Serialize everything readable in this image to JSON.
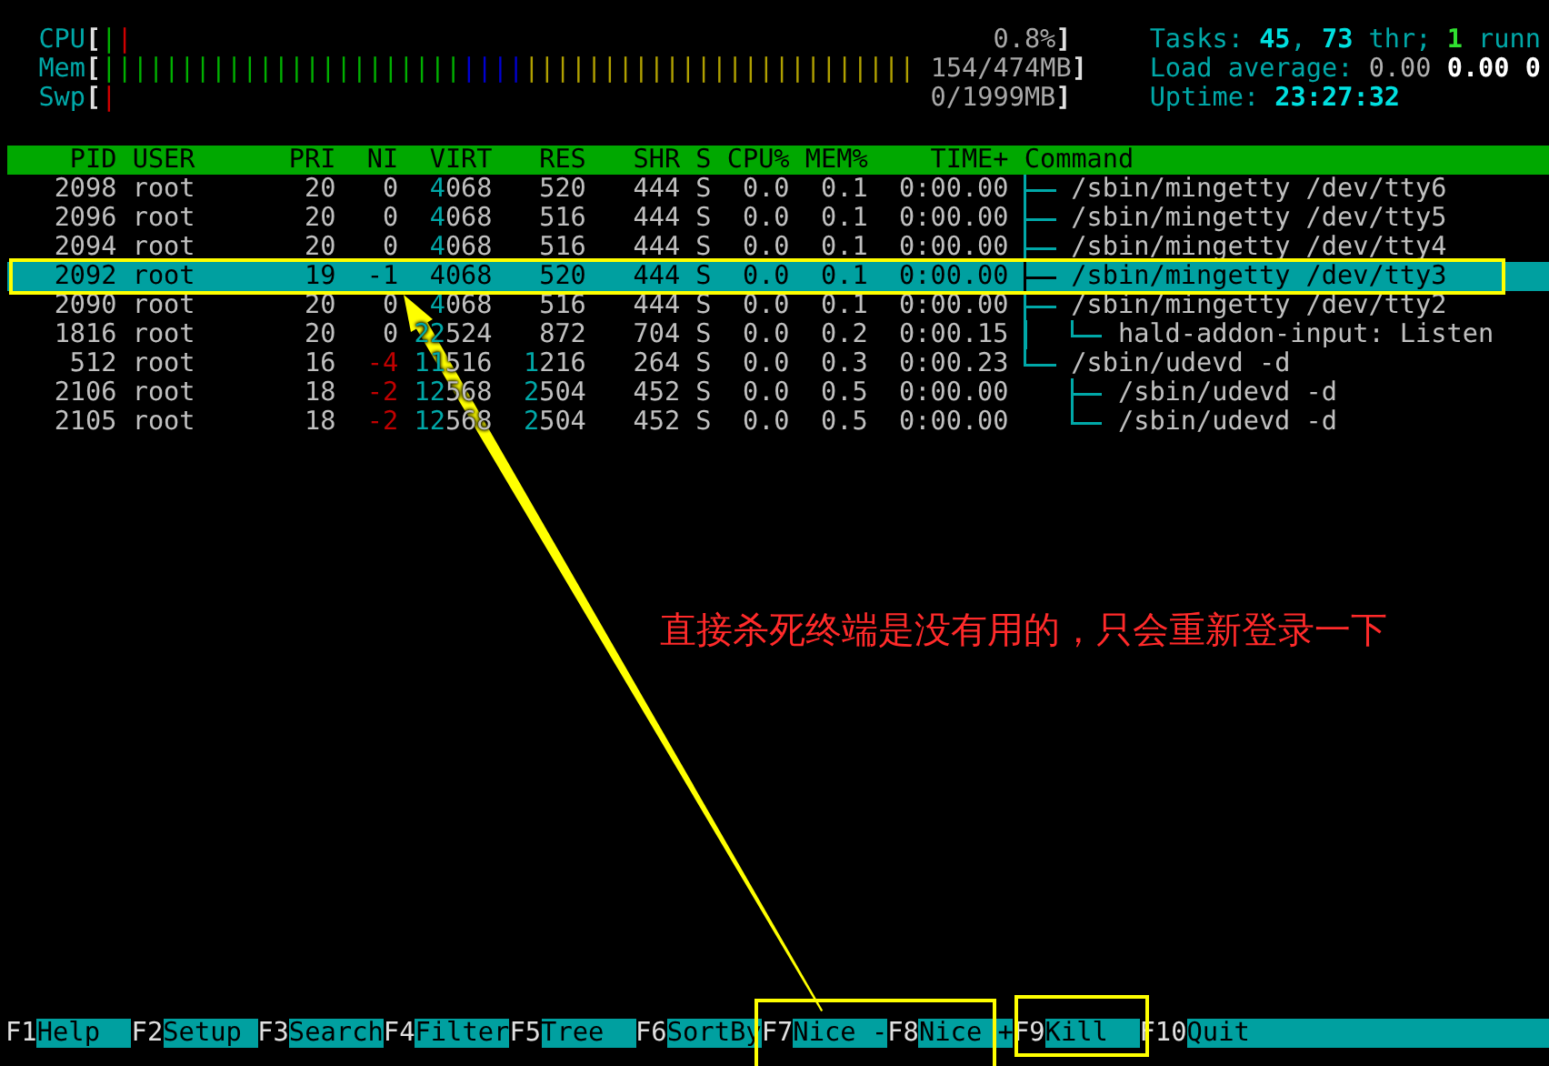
{
  "meters": [
    {
      "label": "CPU",
      "open_bracket": "[",
      "close_bracket": "]",
      "value": "0.8%",
      "segments": [
        {
          "color": "#00b000",
          "bars": "|"
        },
        {
          "color": "#d00000",
          "bars": "|"
        }
      ]
    },
    {
      "label": "Mem",
      "open_bracket": "[",
      "close_bracket": "]",
      "value": "154/474MB",
      "segments": [
        {
          "color": "#00b000",
          "bars": "|||||||||||||||||||||||"
        },
        {
          "color": "#0000d0",
          "bars": "||||"
        },
        {
          "color": "#b0a000",
          "bars": "|||||||||||||||||||||||||"
        }
      ]
    },
    {
      "label": "Swp",
      "open_bracket": "[",
      "close_bracket": "]",
      "value": "0/1999MB",
      "segments": [
        {
          "color": "#d00000",
          "bars": "|"
        }
      ]
    }
  ],
  "stats": [
    [
      {
        "text": "Tasks:",
        "kind": "label"
      },
      {
        "text": "45",
        "kind": "value"
      },
      {
        "text": ",",
        "kind": "punct"
      },
      {
        "text": "73",
        "kind": "value"
      },
      {
        "text": "thr;",
        "kind": "label"
      },
      {
        "text": "1",
        "kind": "running"
      },
      {
        "text": "runn",
        "kind": "label"
      }
    ],
    [
      {
        "text": "Load average:",
        "kind": "label"
      },
      {
        "text": "0.00",
        "kind": "load"
      },
      {
        "text": "0.00",
        "kind": "load_bright"
      },
      {
        "text": "0",
        "kind": "load_bright"
      }
    ],
    [
      {
        "text": "Uptime:",
        "kind": "label"
      },
      {
        "text": "23:27:32",
        "kind": "value"
      }
    ]
  ],
  "columns": [
    "PID",
    "USER",
    "PRI",
    "NI",
    "VIRT",
    "RES",
    "SHR",
    "S",
    "CPU%",
    "MEM%",
    "TIME+",
    "Command"
  ],
  "rows": [
    {
      "pid": "2098",
      "user": "root",
      "pri": "20",
      "ni": "0",
      "nice_negative": false,
      "virt": "4068",
      "res": "520",
      "shr": "444",
      "s": "S",
      "cpu": "0.0",
      "mem": "0.1",
      "time": "0:00.00",
      "command": "/sbin/mingetty /dev/tty6",
      "selected": false
    },
    {
      "pid": "2096",
      "user": "root",
      "pri": "20",
      "ni": "0",
      "nice_negative": false,
      "virt": "4068",
      "res": "516",
      "shr": "444",
      "s": "S",
      "cpu": "0.0",
      "mem": "0.1",
      "time": "0:00.00",
      "command": "/sbin/mingetty /dev/tty5",
      "selected": false
    },
    {
      "pid": "2094",
      "user": "root",
      "pri": "20",
      "ni": "0",
      "nice_negative": false,
      "virt": "4068",
      "res": "516",
      "shr": "444",
      "s": "S",
      "cpu": "0.0",
      "mem": "0.1",
      "time": "0:00.00",
      "command": "/sbin/mingetty /dev/tty4",
      "selected": false
    },
    {
      "pid": "2092",
      "user": "root",
      "pri": "19",
      "ni": "-1",
      "nice_negative": false,
      "virt": "4068",
      "res": "520",
      "shr": "444",
      "s": "S",
      "cpu": "0.0",
      "mem": "0.1",
      "time": "0:00.00",
      "command": "/sbin/mingetty /dev/tty3",
      "selected": true
    },
    {
      "pid": "2090",
      "user": "root",
      "pri": "20",
      "ni": "0",
      "nice_negative": false,
      "virt": "4068",
      "res": "516",
      "shr": "444",
      "s": "S",
      "cpu": "0.0",
      "mem": "0.1",
      "time": "0:00.00",
      "command": "/sbin/mingetty /dev/tty2",
      "selected": false,
      "children": [
        {
          "pid": "1816",
          "user": "root",
          "pri": "20",
          "ni": "0",
          "nice_negative": false,
          "virt": "22524",
          "res": "872",
          "shr": "704",
          "s": "S",
          "cpu": "0.0",
          "mem": "0.2",
          "time": "0:00.15",
          "command": "hald-addon-input: Listen",
          "selected": false
        }
      ]
    },
    {
      "pid": "512",
      "user": "root",
      "pri": "16",
      "ni": "-4",
      "nice_negative": true,
      "virt": "11516",
      "res": "1216",
      "shr": "264",
      "s": "S",
      "cpu": "0.0",
      "mem": "0.3",
      "time": "0:00.23",
      "command": "/sbin/udevd -d",
      "selected": false,
      "children": [
        {
          "pid": "2106",
          "user": "root",
          "pri": "18",
          "ni": "-2",
          "nice_negative": true,
          "virt": "12568",
          "res": "2504",
          "shr": "452",
          "s": "S",
          "cpu": "0.0",
          "mem": "0.5",
          "time": "0:00.00",
          "command": "/sbin/udevd -d",
          "selected": false
        },
        {
          "pid": "2105",
          "user": "root",
          "pri": "18",
          "ni": "-2",
          "nice_negative": true,
          "virt": "12568",
          "res": "2504",
          "shr": "452",
          "s": "S",
          "cpu": "0.0",
          "mem": "0.5",
          "time": "0:00.00",
          "command": "/sbin/udevd -d",
          "selected": false
        }
      ]
    }
  ],
  "function_keys": [
    {
      "key": "F1",
      "label": "Help"
    },
    {
      "key": "F2",
      "label": "Setup"
    },
    {
      "key": "F3",
      "label": "Search"
    },
    {
      "key": "F4",
      "label": "Filter"
    },
    {
      "key": "F5",
      "label": "Tree"
    },
    {
      "key": "F6",
      "label": "SortBy"
    },
    {
      "key": "F7",
      "label": "Nice -"
    },
    {
      "key": "F8",
      "label": "Nice +"
    },
    {
      "key": "F9",
      "label": "Kill"
    },
    {
      "key": "F10",
      "label": "Quit"
    }
  ],
  "annotation": {
    "text": "直接杀死终端是没有用的，只会重新登录一下"
  }
}
